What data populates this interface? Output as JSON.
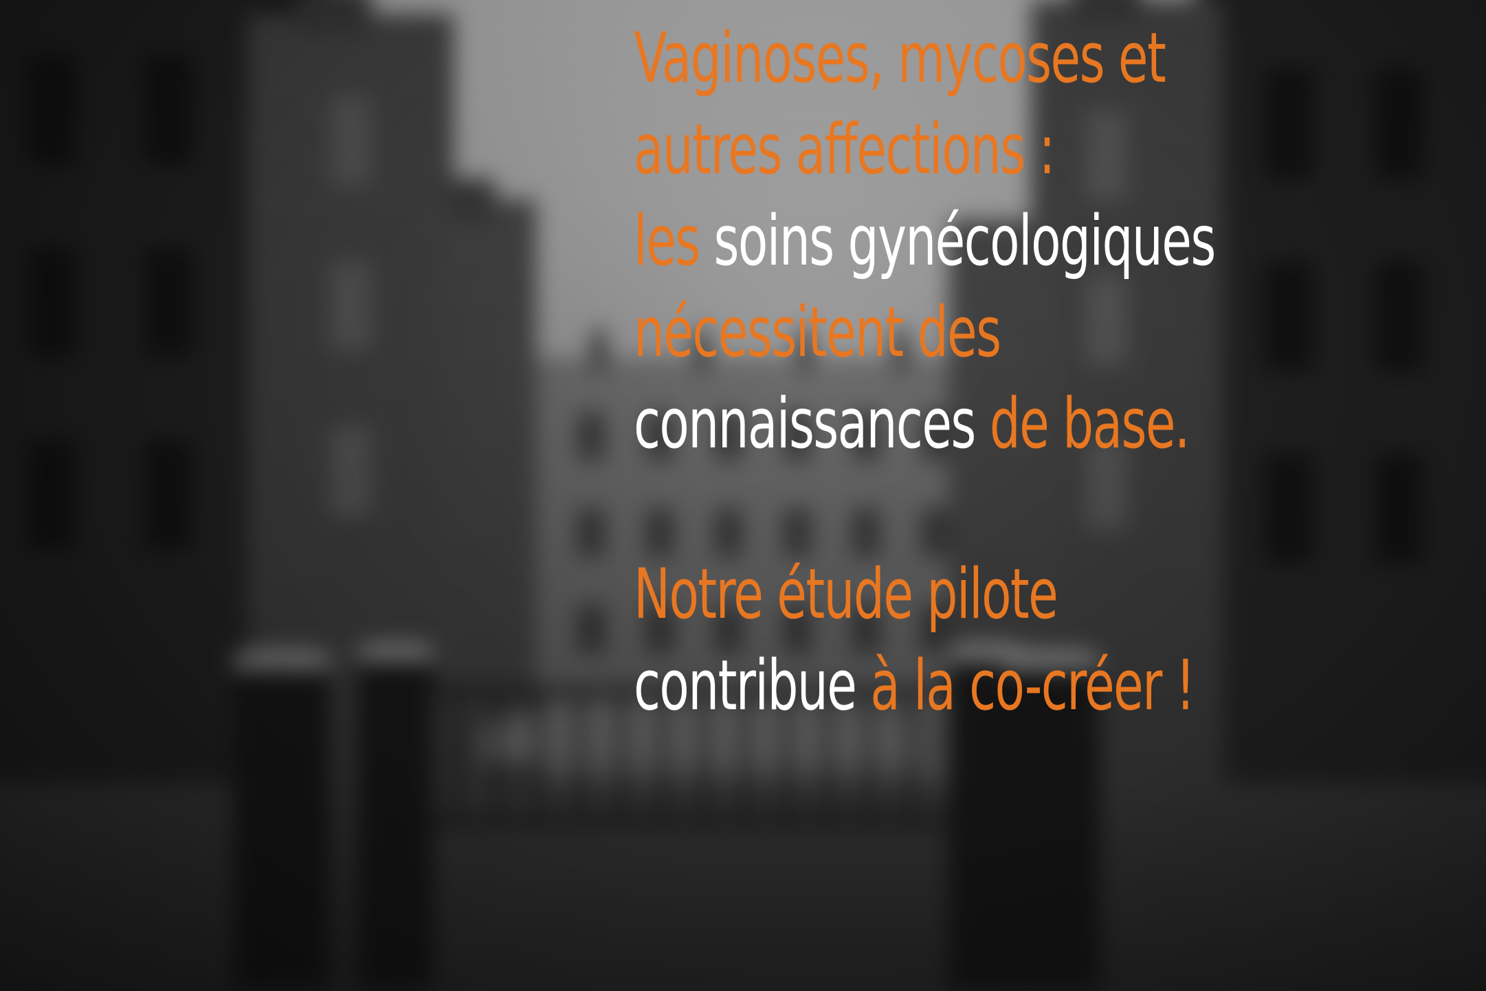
{
  "colors": {
    "accent": "#e87722",
    "highlight": "#ffffff",
    "background": "#1e1e1e"
  },
  "background_image": "blurred black-and-white photo of a courtyard between brick apartment buildings with a gated entrance in snow",
  "text": {
    "line1": "Vaginoses, mycoses et",
    "line2": "autres affections :",
    "line3_a": "les",
    "line3_b": "soins gynécologiques",
    "line4": "nécessitent des",
    "line5_a": "connaissances",
    "line5_b": "de base.",
    "line6": "Notre étude pilote",
    "line7_a": "contribue",
    "line7_b": "à la co-créer !"
  }
}
